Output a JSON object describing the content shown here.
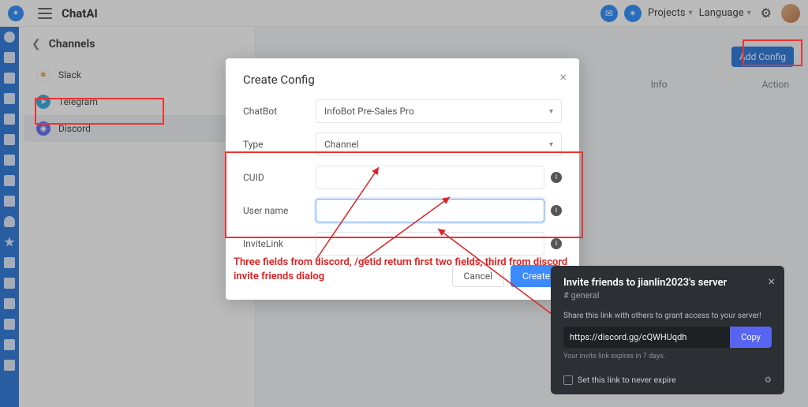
{
  "brand": "ChatAI",
  "topnav": {
    "projects": "Projects",
    "language": "Language"
  },
  "channels": {
    "title": "Channels",
    "items": [
      {
        "label": "Slack",
        "color": "#e8a33d"
      },
      {
        "label": "Telegram",
        "color": "#2aa6e0"
      },
      {
        "label": "Discord",
        "color": "#5865f2"
      }
    ]
  },
  "main": {
    "add_config": "Add Config",
    "col_info": "Info",
    "col_action": "Action"
  },
  "modal": {
    "title": "Create Config",
    "labels": {
      "chatbot": "ChatBot",
      "type": "Type",
      "cuid": "CUID",
      "username": "User name",
      "invite": "InviteLink"
    },
    "values": {
      "chatbot": "InfoBot Pre-Sales Pro",
      "type": "Channel",
      "cuid": "",
      "username": "",
      "invite": ""
    },
    "cancel": "Cancel",
    "create": "Create"
  },
  "annotation": "Three fields from discord, /getid return first two fields, third from discord invite friends dialog",
  "discord": {
    "title": "Invite friends to jianlin2023's server",
    "channel": "# general",
    "share": "Share this link with others to grant access to your server!",
    "link": "https://discord.gg/cQWHUqdh",
    "copy": "Copy",
    "expire": "Your invite link expires in 7 days.",
    "never": "Set this link to never expire"
  }
}
